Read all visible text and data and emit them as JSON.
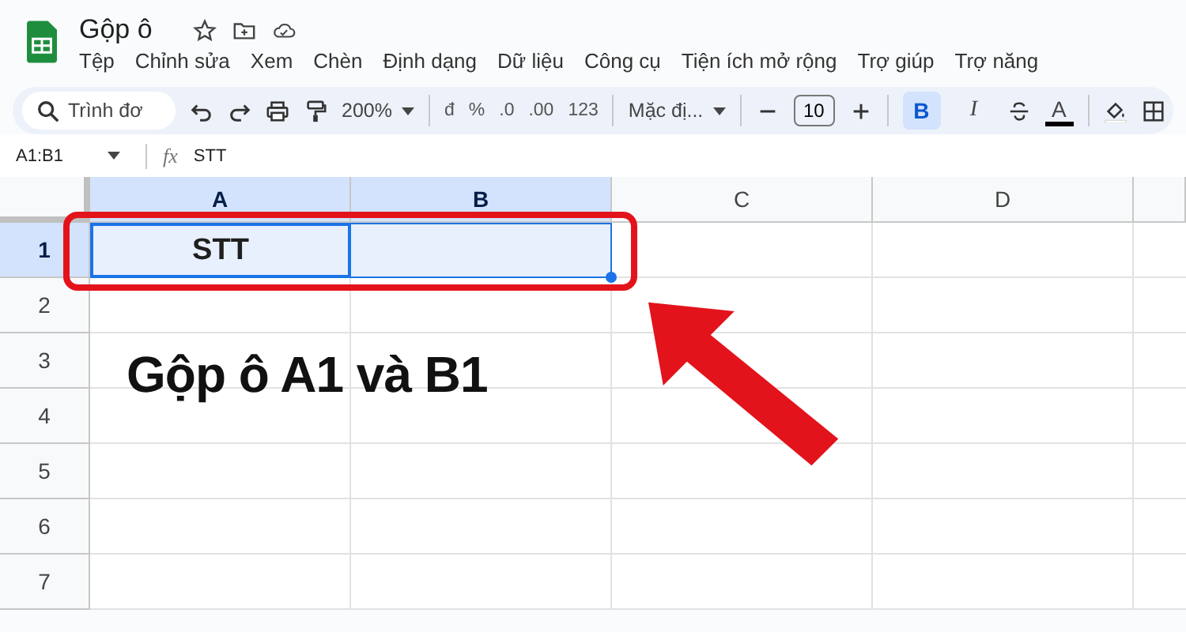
{
  "app": {
    "title": "Gộp ô"
  },
  "menu": [
    "Tệp",
    "Chỉnh sửa",
    "Xem",
    "Chèn",
    "Định dạng",
    "Dữ liệu",
    "Công cụ",
    "Tiện ích mở rộng",
    "Trợ giúp",
    "Trợ năng"
  ],
  "toolbar": {
    "search": {
      "placeholder": "Trình đơ"
    },
    "zoom": "200%",
    "formats": [
      "đ",
      "%",
      ".0",
      ".00",
      "123"
    ],
    "font": "Mặc đị...",
    "font_size": "10",
    "bold": {
      "label": "B",
      "selected": true
    },
    "italic": {
      "label": "I",
      "selected": false
    },
    "text_color": {
      "label": "A"
    }
  },
  "formula_bar": {
    "name_box": "A1:B1",
    "fx": "fx",
    "value": "STT"
  },
  "grid": {
    "columns": [
      {
        "label": "A",
        "selected": true
      },
      {
        "label": "B",
        "selected": true
      },
      {
        "label": "C",
        "selected": false
      },
      {
        "label": "D",
        "selected": false
      }
    ],
    "rows": [
      {
        "label": "1",
        "selected": true,
        "values": [
          "STT"
        ]
      },
      {
        "label": "2",
        "selected": false
      },
      {
        "label": "3",
        "selected": false
      },
      {
        "label": "4",
        "selected": false
      },
      {
        "label": "5",
        "selected": false
      },
      {
        "label": "6",
        "selected": false
      },
      {
        "label": "7",
        "selected": false
      }
    ]
  },
  "annotation": {
    "caption": "Gộp ô A1 và B1"
  }
}
